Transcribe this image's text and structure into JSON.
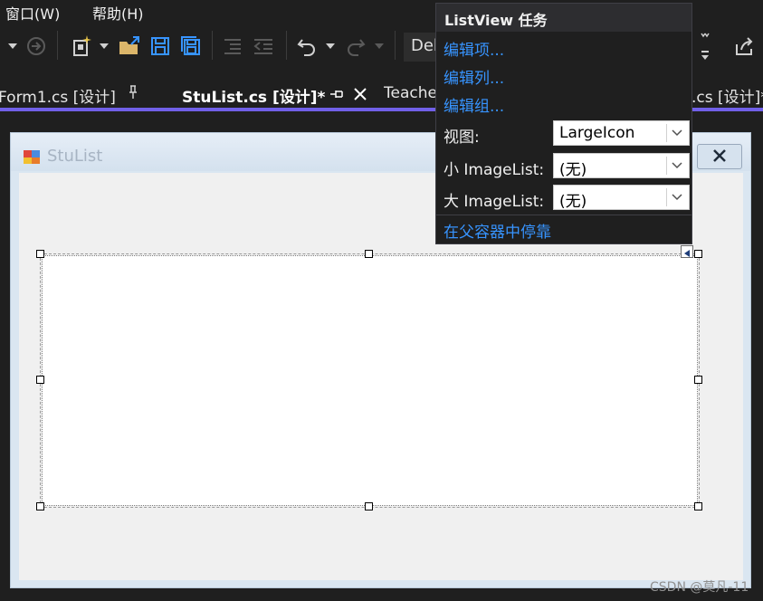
{
  "menubar": {
    "items": [
      {
        "label": "窗口(W)"
      },
      {
        "label": "帮助(H)"
      }
    ]
  },
  "toolbar": {
    "config_label": "Deb"
  },
  "tabs": [
    {
      "label": "Form1.cs [设计]",
      "active": false
    },
    {
      "label": "StuList.cs [设计]*",
      "active": true
    },
    {
      "label": "Teache",
      "active": false
    },
    {
      "label": ".cs [设计]*",
      "active": false
    }
  ],
  "form": {
    "title": "StuList"
  },
  "tasks_panel": {
    "title": "ListView 任务",
    "links": {
      "edit_items": "编辑项...",
      "edit_columns": "编辑列...",
      "edit_groups": "编辑组..."
    },
    "view_label": "视图:",
    "view_value": "LargeIcon",
    "small_imagelist_label": "小 ImageList:",
    "small_imagelist_value": "(无)",
    "large_imagelist_label": "大 ImageList:",
    "large_imagelist_value": "(无)",
    "dock_link": "在父容器中停靠"
  },
  "colors": {
    "accent": "#7160e8",
    "link": "#3794ff",
    "background": "#1f1f1f"
  },
  "watermark": "CSDN @莫凡-11"
}
